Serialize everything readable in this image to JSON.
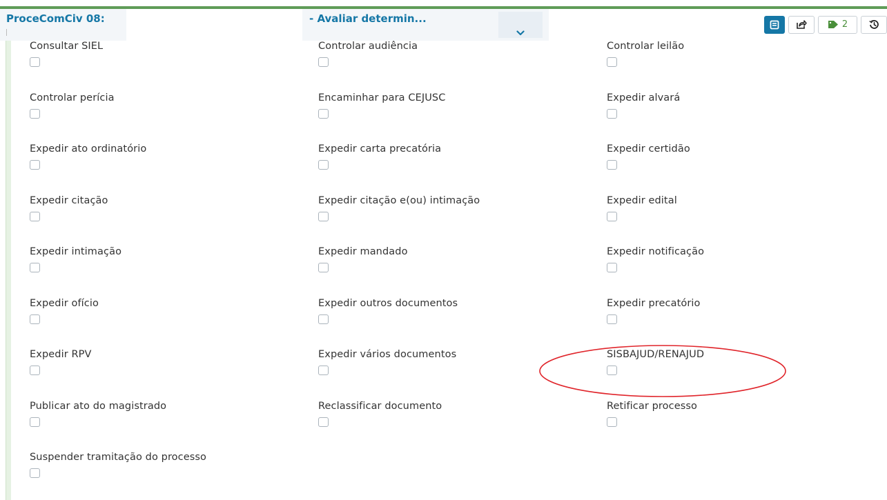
{
  "header": {
    "process_title": "ProceComCiv 08:",
    "task_title": "- Avaliar determin...",
    "tags_count": "2"
  },
  "icons": {
    "chevron": "chevron-down-icon",
    "details": "document-icon",
    "share": "share-icon",
    "tag": "tag-icon",
    "history": "history-icon"
  },
  "colors": {
    "accent": "#1577a6",
    "stripe": "#5f9c58",
    "tag": "#4a8f3a",
    "annotation": "#e0242a"
  },
  "options": [
    "Consultar SIEL",
    "Controlar audiência",
    "Controlar leilão",
    "Controlar perícia",
    "Encaminhar para CEJUSC",
    "Expedir alvará",
    "Expedir ato ordinatório",
    "Expedir carta precatória",
    "Expedir certidão",
    "Expedir citação",
    "Expedir citação e(ou) intimação",
    "Expedir edital",
    "Expedir intimação",
    "Expedir mandado",
    "Expedir notificação",
    "Expedir ofício",
    "Expedir outros documentos",
    "Expedir precatório",
    "Expedir RPV",
    "Expedir vários documentos",
    "SISBAJUD/RENAJUD",
    "Publicar ato do magistrado",
    "Reclassificar documento",
    "Retificar processo",
    "Suspender tramitação do processo"
  ]
}
